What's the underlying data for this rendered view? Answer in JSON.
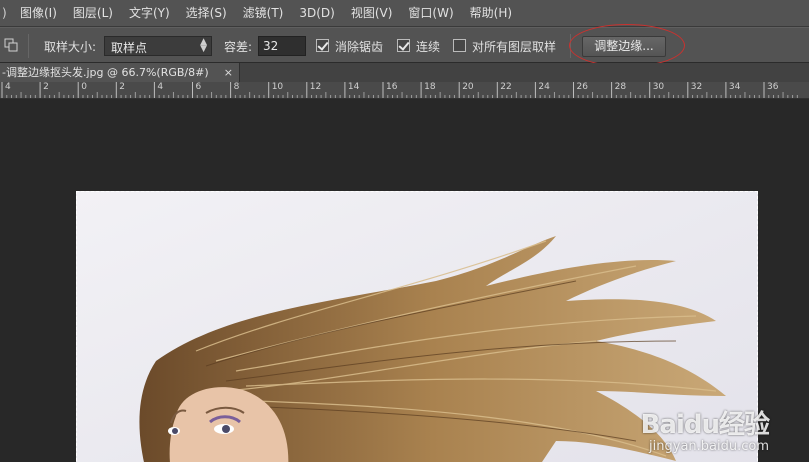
{
  "menu": {
    "edge": ")",
    "items": [
      "图像(I)",
      "图层(L)",
      "文字(Y)",
      "选择(S)",
      "滤镜(T)",
      "3D(D)",
      "视图(V)",
      "窗口(W)",
      "帮助(H)"
    ]
  },
  "options": {
    "sample_size_label": "取样大小:",
    "sample_size_value": "取样点",
    "tolerance_label": "容差:",
    "tolerance_value": "32",
    "anti_alias_label": "消除锯齿",
    "anti_alias_checked": true,
    "contiguous_label": "连续",
    "contiguous_checked": true,
    "all_layers_label": "对所有图层取样",
    "all_layers_checked": false,
    "refine_edge_label": "调整边缘..."
  },
  "document_tab": {
    "title": "-调整边缘抠头发.jpg @ 66.7%(RGB/8#)",
    "close": "×"
  },
  "ruler": {
    "labels": [
      "4",
      "2",
      "0",
      "2",
      "4",
      "6",
      "8",
      "10",
      "12",
      "14",
      "16",
      "18",
      "20",
      "22",
      "24",
      "26",
      "28",
      "30",
      "32",
      "34",
      "36"
    ]
  },
  "watermark": {
    "main": "Baidu经验",
    "sub": "jingyan.baidu.com"
  },
  "colors": {
    "ui_bg": "#535353",
    "canvas_bg": "#282828",
    "highlight_ellipse": "#c8322f"
  }
}
